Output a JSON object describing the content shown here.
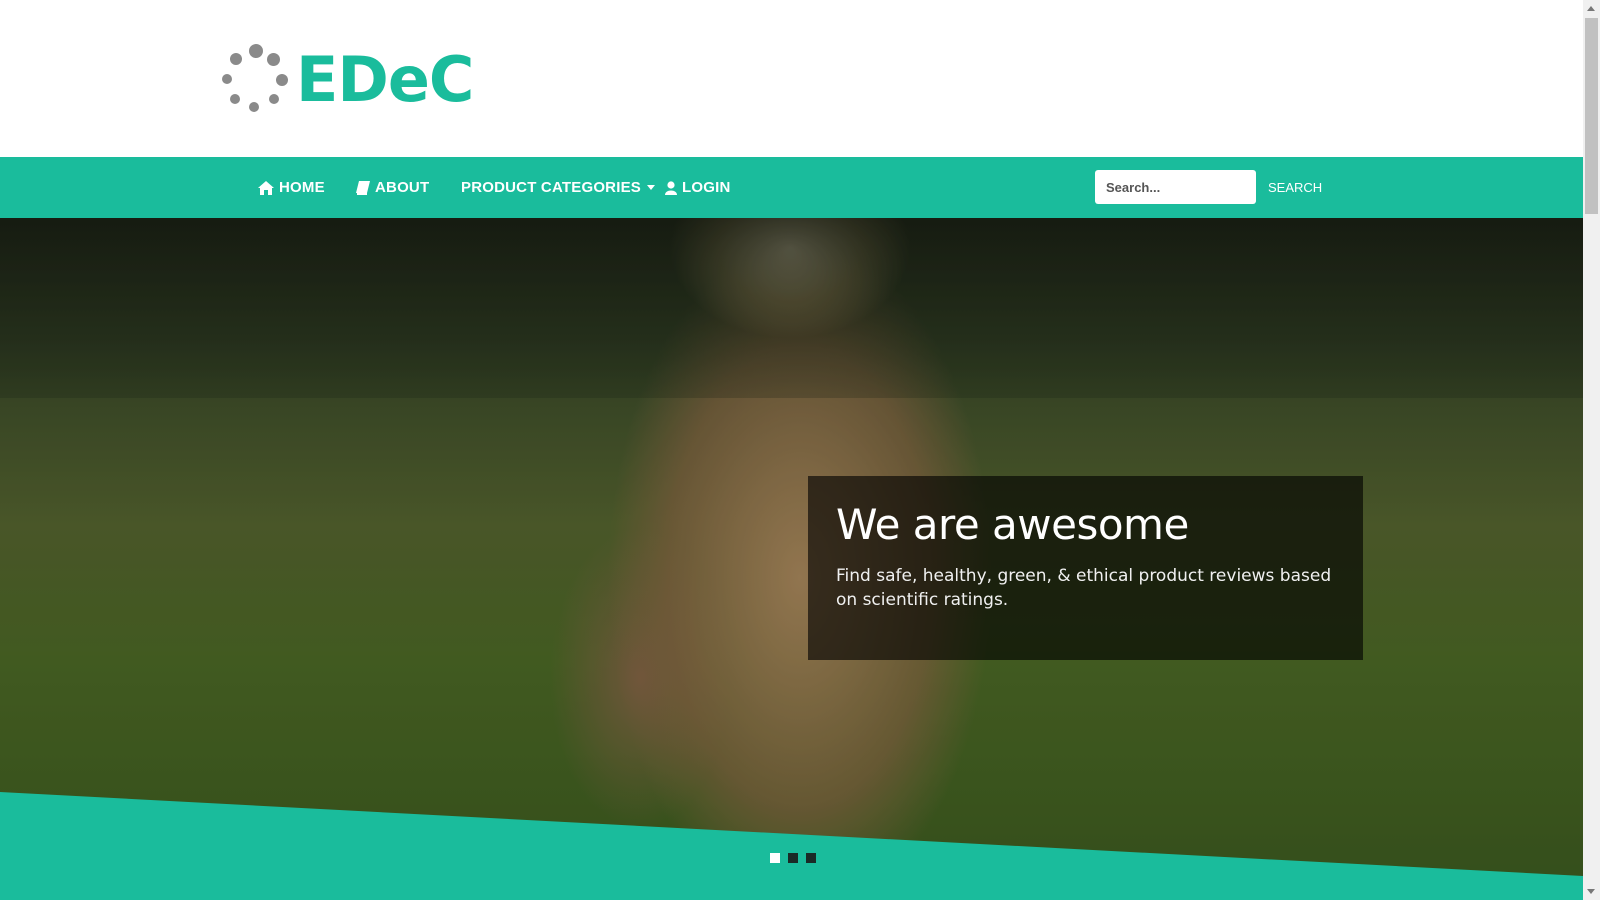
{
  "brand": {
    "name": "EDeC",
    "accent": "#1abc9c",
    "dots_color": "#8a8a8a"
  },
  "nav": {
    "items": [
      {
        "label": "HOME",
        "icon": "home-icon"
      },
      {
        "label": "ABOUT",
        "icon": "book-icon"
      },
      {
        "label": "PRODUCT CATEGORIES",
        "icon": "caret-down-icon"
      },
      {
        "label": "LOGIN",
        "icon": "user-icon"
      }
    ],
    "search_placeholder": "Search...",
    "search_button": "SEARCH"
  },
  "hero": {
    "title": "We are awesome",
    "subtitle": "Find safe, healthy, green, & ethical product reviews based on scientific ratings.",
    "slides": 3,
    "active_slide": 1
  }
}
